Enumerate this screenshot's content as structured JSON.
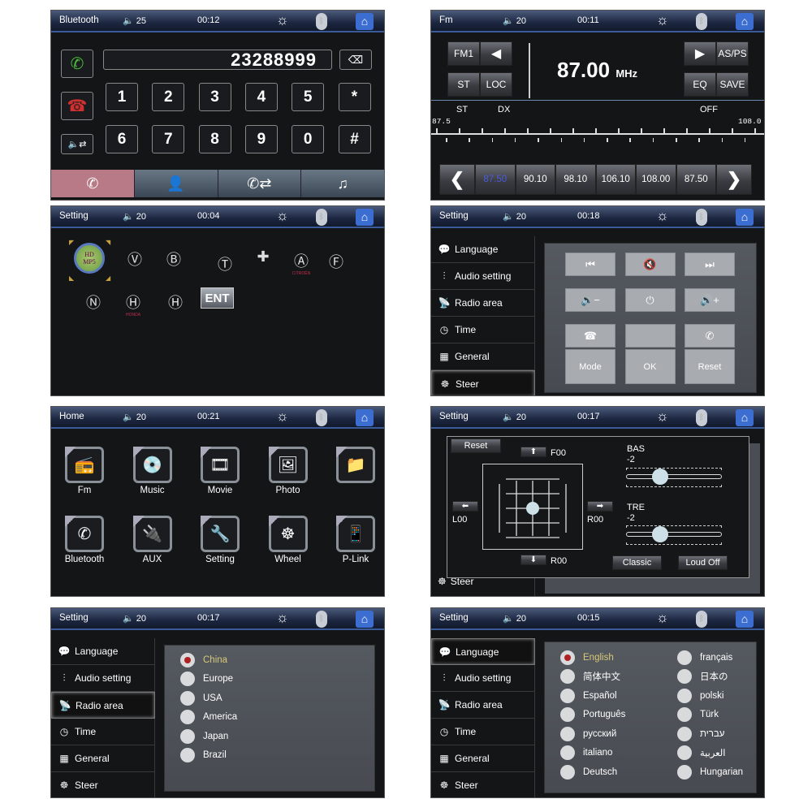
{
  "screens": {
    "bluetooth": {
      "header": {
        "title": "Bluetooth",
        "volume": "25",
        "time": "00:12"
      },
      "number_display": "23288999",
      "keys": [
        "1",
        "2",
        "3",
        "4",
        "5",
        "*",
        "6",
        "7",
        "8",
        "9",
        "0",
        "#"
      ],
      "side_buttons": [
        "call-icon",
        "hangup-icon",
        "audio-transfer-icon"
      ],
      "tabs": [
        {
          "icon": "phone-icon",
          "active": true
        },
        {
          "icon": "contacts-icon",
          "active": false
        },
        {
          "icon": "call-log-icon",
          "active": false
        },
        {
          "icon": "music-icon",
          "active": false
        }
      ],
      "accent_active_tab": "#b87a86"
    },
    "fm": {
      "header": {
        "title": "Fm",
        "volume": "20",
        "time": "00:11"
      },
      "band": "FM1",
      "buttons": {
        "st": "ST",
        "loc": "LOC",
        "asps": "AS/PS",
        "eq": "EQ",
        "save": "SAVE"
      },
      "frequency": "87.00",
      "unit": "MHz",
      "status": {
        "st": "ST",
        "dx": "DX",
        "off": "OFF"
      },
      "scale": {
        "min": "87.5",
        "max": "108.0"
      },
      "presets": [
        "87.50",
        "90.10",
        "98.10",
        "106.10",
        "108.00",
        "87.50"
      ],
      "active_preset_index": 0,
      "active_preset_color": "#4a5adc"
    },
    "car_logo": {
      "header": {
        "title": "Setting",
        "volume": "20",
        "time": "00:04"
      },
      "logos": [
        "HD MP5",
        "VW",
        "Buick",
        "Toyota",
        "Chevrolet",
        "CITROËN",
        "Ford",
        "Nissan",
        "HONDA",
        "Hyundai"
      ],
      "enter_label": "ENT"
    },
    "steer": {
      "header": {
        "title": "Setting",
        "volume": "20",
        "time": "00:18"
      },
      "menu": [
        "Language",
        "Audio setting",
        "Radio area",
        "Time",
        "General",
        "Steer"
      ],
      "selected": "Steer",
      "grid": [
        {
          "icon": "prev-track-icon",
          "label": "⏮"
        },
        {
          "icon": "mute-icon",
          "label": "🔇"
        },
        {
          "icon": "next-track-icon",
          "label": "⏭"
        },
        {
          "icon": "volume-down-icon",
          "label": "🔉−"
        },
        {
          "icon": "power-icon",
          "label": "⏻"
        },
        {
          "icon": "volume-up-icon",
          "label": "🔊+"
        },
        {
          "icon": "hangup-icon",
          "label": "☎"
        },
        {
          "icon": "blank",
          "label": ""
        },
        {
          "icon": "answer-icon",
          "label": "✆"
        },
        {
          "icon": "",
          "label": "Mode"
        },
        {
          "icon": "",
          "label": "OK"
        },
        {
          "icon": "",
          "label": "Reset"
        }
      ]
    },
    "home": {
      "header": {
        "title": "Home",
        "volume": "20",
        "time": "00:21"
      },
      "apps": [
        {
          "label": "Fm",
          "icon": "radio-icon",
          "glyph": "📻"
        },
        {
          "label": "Music",
          "icon": "music-icon",
          "glyph": "💿"
        },
        {
          "label": "Movie",
          "icon": "film-reel-icon",
          "glyph": "🎞"
        },
        {
          "label": "Photo",
          "icon": "photo-icon",
          "glyph": "🖼"
        },
        {
          "label": "",
          "icon": "folder-icon",
          "glyph": "📁"
        },
        {
          "label": "Bluetooth",
          "icon": "bluetooth-phone-icon",
          "glyph": "✆"
        },
        {
          "label": "AUX",
          "icon": "aux-cable-icon",
          "glyph": "🔌"
        },
        {
          "label": "Setting",
          "icon": "wrench-icon",
          "glyph": "🔧"
        },
        {
          "label": "Wheel",
          "icon": "steering-wheel-icon",
          "glyph": "☸"
        },
        {
          "label": "P-Link",
          "icon": "phone-link-icon",
          "glyph": "📱"
        }
      ]
    },
    "audio": {
      "header": {
        "title": "Setting",
        "volume": "20",
        "time": "00:17"
      },
      "reset": "Reset",
      "fader": {
        "front": "F00",
        "rear": "R00",
        "left": "L00",
        "right": "R00"
      },
      "bass": {
        "label": "BAS",
        "value": "-2",
        "level": -2,
        "range": [
          -7,
          7
        ]
      },
      "treble": {
        "label": "TRE",
        "value": "-2",
        "level": -2,
        "range": [
          -7,
          7
        ]
      },
      "preset": "Classic",
      "loudness": "Loud Off",
      "menu_visible": "Steer"
    },
    "radio_area": {
      "header": {
        "title": "Setting",
        "volume": "20",
        "time": "00:17"
      },
      "menu": [
        "Language",
        "Audio setting",
        "Radio area",
        "Time",
        "General",
        "Steer"
      ],
      "selected": "Radio area",
      "options": [
        "China",
        "Europe",
        "USA",
        "America",
        "Japan",
        "Brazil"
      ],
      "selected_option": "China"
    },
    "language": {
      "header": {
        "title": "Setting",
        "volume": "20",
        "time": "00:15"
      },
      "menu": [
        "Language",
        "Audio setting",
        "Radio area",
        "Time",
        "General",
        "Steer"
      ],
      "selected": "Language",
      "options_left": [
        "English",
        "简体中文",
        "Español",
        "Português",
        "русский",
        "italiano",
        "Deutsch"
      ],
      "options_right": [
        "français",
        "日本の",
        "polski",
        "Türk",
        "עברית",
        "العربية",
        "Hungarian"
      ],
      "selected_option": "English"
    }
  },
  "menu_icons": [
    "chat-bubbles-icon",
    "equalizer-icon",
    "antenna-icon",
    "clock-icon",
    "grid-icon",
    "steering-wheel-icon"
  ],
  "menu_glyphs": [
    "💬",
    "⫶",
    "📡",
    "◷",
    "▦",
    "☸"
  ]
}
